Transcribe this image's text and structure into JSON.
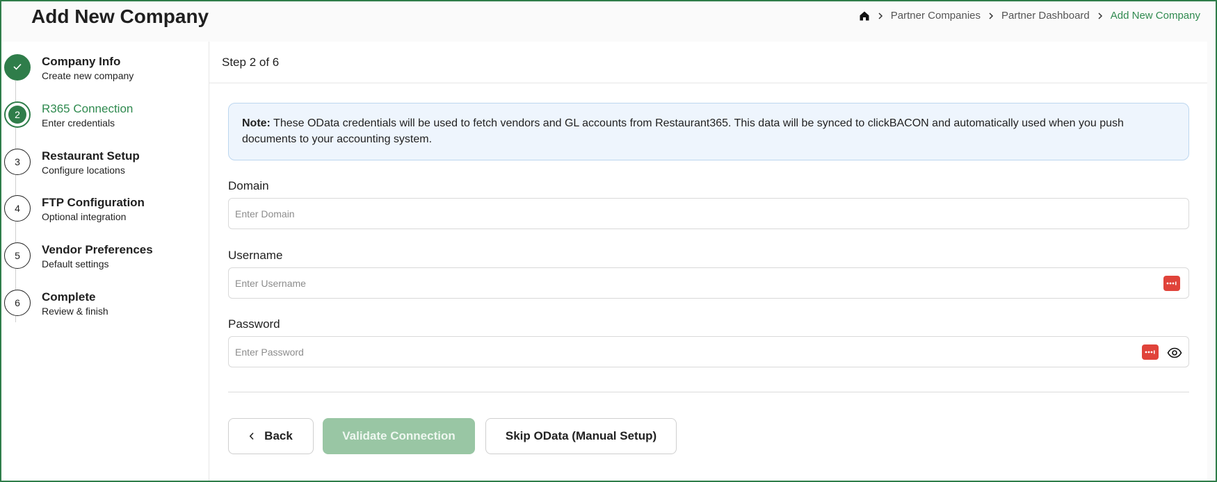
{
  "header": {
    "title": "Add New Company",
    "breadcrumb": [
      "Partner Companies",
      "Partner Dashboard",
      "Add New Company"
    ]
  },
  "steps": [
    {
      "number": "1",
      "title": "Company Info",
      "subtitle": "Create new company",
      "state": "done"
    },
    {
      "number": "2",
      "title": "R365 Connection",
      "subtitle": "Enter credentials",
      "state": "current"
    },
    {
      "number": "3",
      "title": "Restaurant Setup",
      "subtitle": "Configure locations",
      "state": "pending"
    },
    {
      "number": "4",
      "title": "FTP Configuration",
      "subtitle": "Optional integration",
      "state": "pending"
    },
    {
      "number": "5",
      "title": "Vendor Preferences",
      "subtitle": "Default settings",
      "state": "pending"
    },
    {
      "number": "6",
      "title": "Complete",
      "subtitle": "Review & finish",
      "state": "pending"
    }
  ],
  "main": {
    "step_indicator": "Step 2 of 6",
    "note": {
      "label": "Note:",
      "text": "These OData credentials will be used to fetch vendors and GL accounts from Restaurant365. This data will be synced to clickBACON and automatically used when you push documents to your accounting system."
    },
    "domain": {
      "label": "Domain",
      "placeholder": "Enter Domain",
      "value": ""
    },
    "username": {
      "label": "Username",
      "placeholder": "Enter Username",
      "value": ""
    },
    "password": {
      "label": "Password",
      "placeholder": "Enter Password",
      "value": ""
    }
  },
  "buttons": {
    "back": "Back",
    "validate": "Validate Connection",
    "skip": "Skip OData (Manual Setup)"
  },
  "colors": {
    "accent": "#2f7d4a",
    "accent_disabled": "#99c6a4",
    "note_bg": "#eef5fd",
    "password_badge": "#e0433a"
  },
  "icons": {
    "home": "home-icon",
    "breadcrumb_separator": "chevron-right-icon",
    "step_done": "check-icon",
    "password_manager": "password-manager-icon",
    "show_password": "eye-icon",
    "back": "chevron-left-icon"
  }
}
